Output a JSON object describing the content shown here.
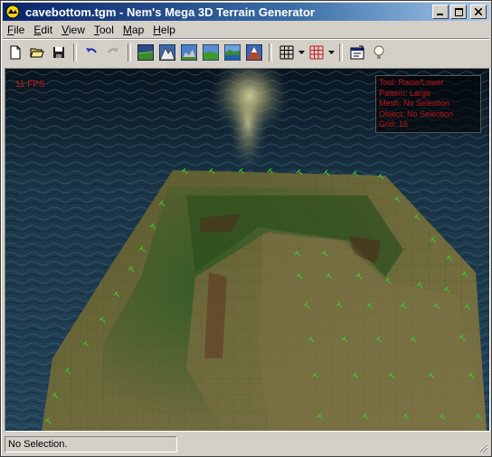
{
  "window": {
    "title": "cavebottom.tgm - Nem's Mega 3D Terrain Generator"
  },
  "menu": [
    {
      "label": "File",
      "mnemonic": "F",
      "rest": "ile"
    },
    {
      "label": "Edit",
      "mnemonic": "E",
      "rest": "dit"
    },
    {
      "label": "View",
      "mnemonic": "V",
      "rest": "iew"
    },
    {
      "label": "Tool",
      "mnemonic": "T",
      "rest": "ool"
    },
    {
      "label": "Map",
      "mnemonic": "M",
      "rest": "ap"
    },
    {
      "label": "Help",
      "mnemonic": "H",
      "rest": "elp"
    }
  ],
  "toolbar": {
    "icons": [
      "new-file-icon",
      "open-folder-icon",
      "save-icon",
      "undo-icon",
      "redo-icon",
      "terrain-flat-icon",
      "terrain-mountain-icon",
      "terrain-hills-icon",
      "terrain-valley-icon",
      "terrain-water-icon",
      "terrain-peak-icon",
      "grid-icon",
      "grid-drop-icon",
      "red-grid-icon",
      "red-grid-drop-icon",
      "properties-icon",
      "lightbulb-icon"
    ]
  },
  "viewport": {
    "fps_text": "11 FPS",
    "info_lines": [
      "Tool: Raise/Lower",
      "Pattern: Large",
      "Mesh: No Selection",
      "Object: No Selection",
      "Grid: 16"
    ]
  },
  "status": {
    "text": "No Selection."
  },
  "colors": {
    "title_start": "#0a246a",
    "title_end": "#a6caf0",
    "overlay_text": "#d01818",
    "water": "#1e3a4e",
    "terrain": "#6f6a3a",
    "grass": "#2e5a22"
  }
}
